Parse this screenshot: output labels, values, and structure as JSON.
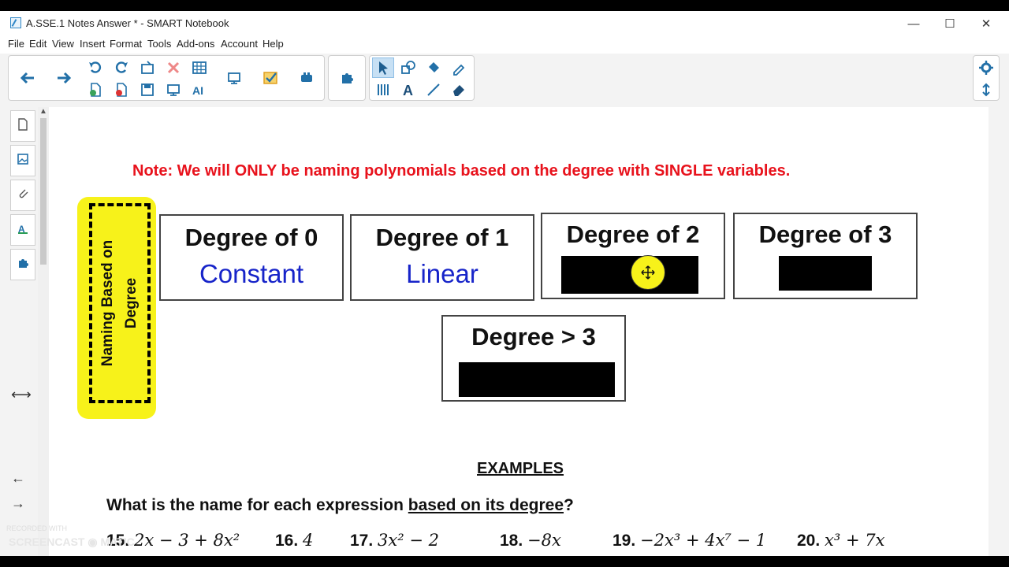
{
  "window": {
    "title": "A.SSE.1 Notes Answer * - SMART Notebook",
    "controls": {
      "minimize": "—",
      "maximize": "☐",
      "close": "✕"
    }
  },
  "menu": [
    "File",
    "Edit",
    "View",
    "Insert",
    "Format",
    "Tools",
    "Add-ons",
    "Account",
    "Help"
  ],
  "toolbar": {
    "nav": [
      "back-arrow-icon",
      "forward-arrow-icon"
    ],
    "edit": [
      "undo-icon",
      "redo-icon",
      "open-file-icon",
      "delete-icon",
      "table-icon",
      "add-page-icon",
      "remove-page-icon",
      "save-icon",
      "screen-shade-icon",
      "text-format-icon",
      "display-icon",
      "response-icon",
      "add-ons-icon",
      "smart-lab-icon"
    ],
    "tools": [
      "select-icon",
      "shapes-icon",
      "fill-icon",
      "magic-pen-icon",
      "measurement-icon",
      "text-icon",
      "line-icon",
      "eraser-icon"
    ],
    "right": [
      "settings-icon",
      "move-toolbar-icon"
    ]
  },
  "sidebar": {
    "tabs": [
      "page-sorter-icon",
      "gallery-icon",
      "attachments-icon",
      "properties-icon",
      "add-ons-icon"
    ],
    "arrows": {
      "resize": "⟷",
      "prev": "←",
      "next": "→"
    }
  },
  "page": {
    "note": "Note: We will ONLY be naming polynomials based on the degree with SINGLE variables.",
    "side_label": {
      "line1": "Naming Based on",
      "line2": "Degree"
    },
    "degrees": [
      {
        "title": "Degree of 0",
        "name": "Constant"
      },
      {
        "title": "Degree of 1",
        "name": "Linear"
      },
      {
        "title": "Degree of 2",
        "name": ""
      },
      {
        "title": "Degree of 3",
        "name": ""
      },
      {
        "title": "Degree > 3",
        "name": ""
      }
    ],
    "examples_heading": "EXAMPLES",
    "question": {
      "before": "What is the name for each expression ",
      "underlined": "based on its degree",
      "after": "?"
    },
    "examples": [
      {
        "num": "15.",
        "expr": "2x − 3 + 8x²"
      },
      {
        "num": "16.",
        "expr": "4"
      },
      {
        "num": "17.",
        "expr": "3x² − 2"
      },
      {
        "num": "18.",
        "expr": "−8x"
      },
      {
        "num": "19.",
        "expr": "−2x³ + 4x⁷ − 1"
      },
      {
        "num": "20.",
        "expr": "x³ + 7x"
      }
    ]
  },
  "watermark": {
    "line1": "RECORDED WITH",
    "line2": "SCREENCAST ◉ MATIC"
  },
  "colors": {
    "note_red": "#e8121c",
    "name_blue": "#1724c9",
    "highlight_yellow": "#f7f21a",
    "accent_blue": "#2f86c6"
  }
}
